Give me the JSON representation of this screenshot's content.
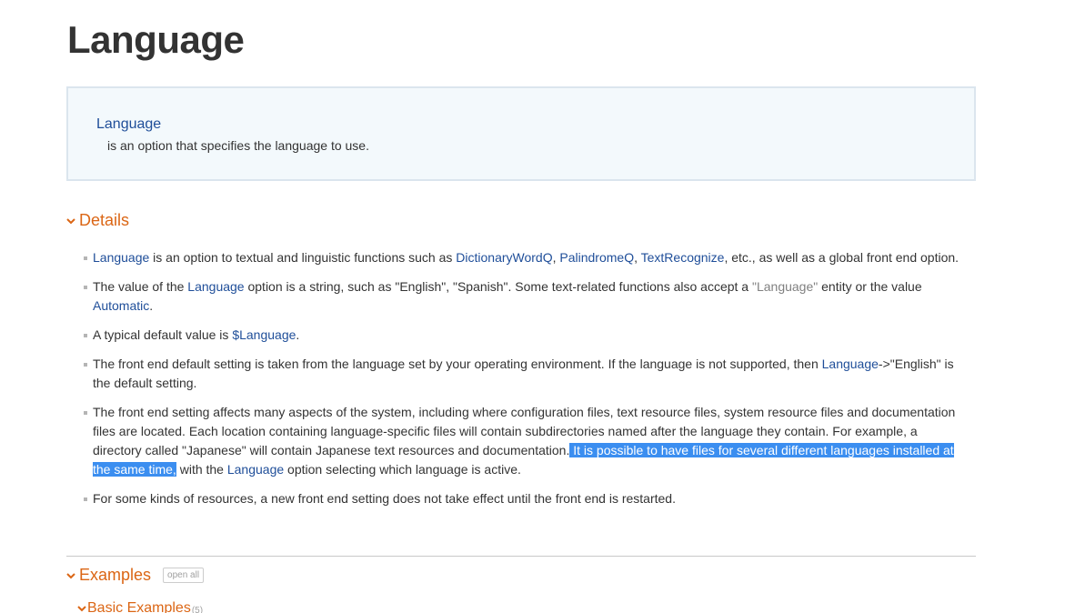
{
  "page": {
    "title": "Language"
  },
  "usage": {
    "code": "Language",
    "description": "is an option that specifies the language to use."
  },
  "details": {
    "title": "Details",
    "items": [
      {
        "parts": [
          {
            "type": "link",
            "text": "Language"
          },
          {
            "type": "text",
            "text": " is an option to textual and linguistic functions such as "
          },
          {
            "type": "link",
            "text": "DictionaryWordQ"
          },
          {
            "type": "text",
            "text": ", "
          },
          {
            "type": "link",
            "text": "PalindromeQ"
          },
          {
            "type": "text",
            "text": ", "
          },
          {
            "type": "link",
            "text": "TextRecognize"
          },
          {
            "type": "text",
            "text": ", etc., as well as a global front end option."
          }
        ]
      },
      {
        "parts": [
          {
            "type": "text",
            "text": "The value of the "
          },
          {
            "type": "link",
            "text": "Language"
          },
          {
            "type": "text",
            "text": " option is a string, such as \"English\", \"Spanish\". Some text-related functions also accept a "
          },
          {
            "type": "entity",
            "text": "\"Language\""
          },
          {
            "type": "text",
            "text": " entity or the value "
          },
          {
            "type": "link",
            "text": "Automatic"
          },
          {
            "type": "text",
            "text": "."
          }
        ]
      },
      {
        "parts": [
          {
            "type": "text",
            "text": "A typical default value is "
          },
          {
            "type": "link",
            "text": "$Language"
          },
          {
            "type": "text",
            "text": "."
          }
        ]
      },
      {
        "parts": [
          {
            "type": "text",
            "text": "The front end default setting is taken from the language set by your operating environment. If the language is not supported, then "
          },
          {
            "type": "link",
            "text": "Language"
          },
          {
            "type": "text",
            "text": "->\"English\" is the default setting."
          }
        ]
      },
      {
        "parts": [
          {
            "type": "text",
            "text": "The front end setting affects many aspects of the system, including where configuration files, text resource files, system resource files and documentation files are located. Each location containing language-specific files will contain subdirectories named after the language they contain. For example, a directory called \"Japanese\" will contain Japanese text resources and documentation."
          },
          {
            "type": "highlight",
            "text": " It is possible to have files for several different languages installed at the same time,"
          },
          {
            "type": "text",
            "text": " with the "
          },
          {
            "type": "link",
            "text": "Language"
          },
          {
            "type": "text",
            "text": " option selecting which language is active."
          }
        ]
      },
      {
        "parts": [
          {
            "type": "text",
            "text": "For some kinds of resources, a new front end setting does not take effect until the front end is restarted."
          }
        ]
      }
    ]
  },
  "examples": {
    "title": "Examples",
    "open_all_label": "open all",
    "basic_title": "Basic Examples",
    "basic_count": "(5)"
  },
  "colors": {
    "section_accent": "#db6615",
    "link": "#1f4e99",
    "selection": "#3b8ef0",
    "usage_bg": "#f3f9fc"
  }
}
